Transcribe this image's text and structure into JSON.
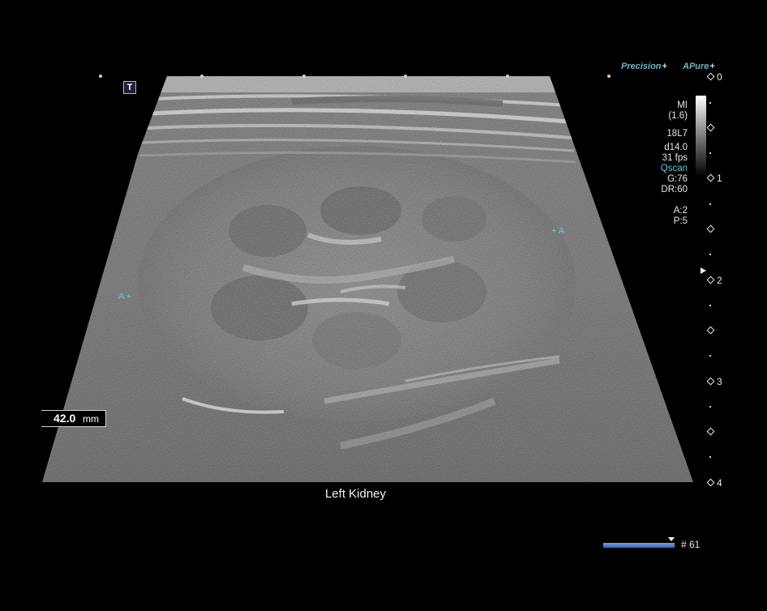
{
  "header": {
    "precision_label": "Precision",
    "apure_label": "Pure",
    "apure_prefix": "A",
    "plus": "+"
  },
  "params": {
    "mi": "MI",
    "mi_value": "(1.6)",
    "probe": "18L7",
    "depth": "d14.0",
    "fps": "31 fps",
    "qscan": "Qscan",
    "gain": "G:76",
    "dynamic_range": "DR:60",
    "a": "A:2",
    "p": "P:5"
  },
  "depth_scale": {
    "labels": [
      "0",
      "1",
      "2",
      "3",
      "4"
    ]
  },
  "toolbar": {
    "t_button": "T"
  },
  "measurement": {
    "value": "42.0",
    "unit": "mm"
  },
  "caption": "Left Kidney",
  "markers": {
    "left": "A +",
    "right": "+ A"
  },
  "cine": {
    "frame_label": "# 61",
    "position_fraction": 0.95
  },
  "colors": {
    "background": "#000000",
    "accent_cyan": "#5cc6d8",
    "cine_blue": "#2d5fc0"
  }
}
